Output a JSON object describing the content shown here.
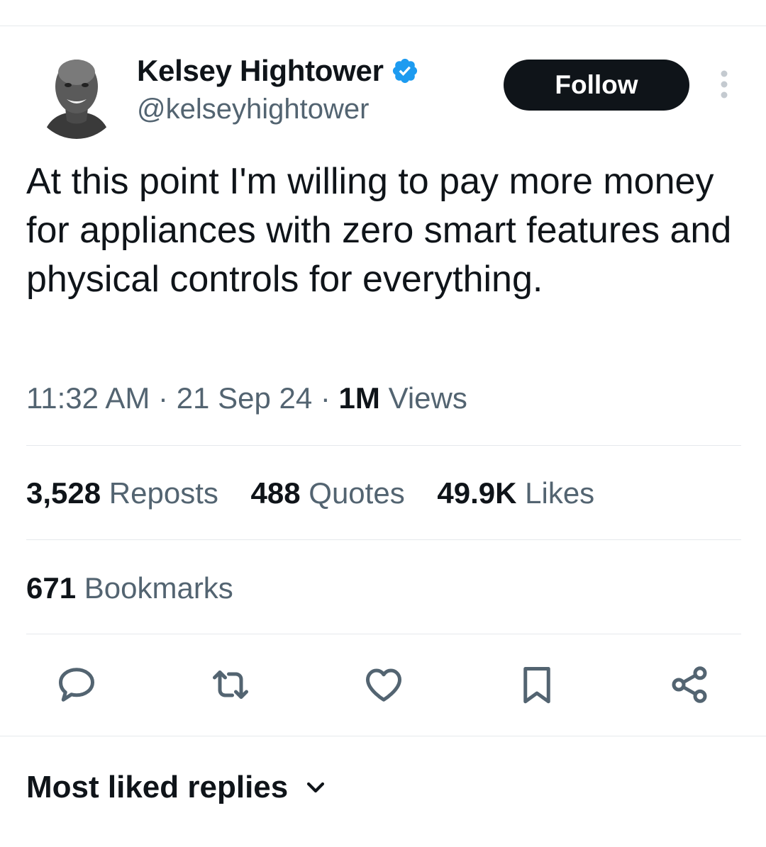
{
  "tweet": {
    "author": {
      "display_name": "Kelsey Hightower",
      "handle": "@kelseyhightower"
    },
    "follow_label": "Follow",
    "text": "At this point I'm willing to pay more money for appliances with zero smart features and physical controls for everything.",
    "time": "11:32 AM",
    "date": "21 Sep 24",
    "separator": "·",
    "views_count": "1M",
    "views_label": "Views"
  },
  "stats": {
    "reposts": {
      "count": "3,528",
      "label": "Reposts"
    },
    "quotes": {
      "count": "488",
      "label": "Quotes"
    },
    "likes": {
      "count": "49.9K",
      "label": "Likes"
    },
    "bookmarks": {
      "count": "671",
      "label": "Bookmarks"
    }
  },
  "actions": [
    "reply-icon",
    "repost-icon",
    "like-icon",
    "bookmark-icon",
    "share-icon"
  ],
  "replies": {
    "sort_label": "Most liked replies"
  },
  "colors": {
    "text": "#0f1419",
    "secondary": "#536471",
    "verified": "#1d9bf0",
    "divider": "#e6e9ec"
  }
}
